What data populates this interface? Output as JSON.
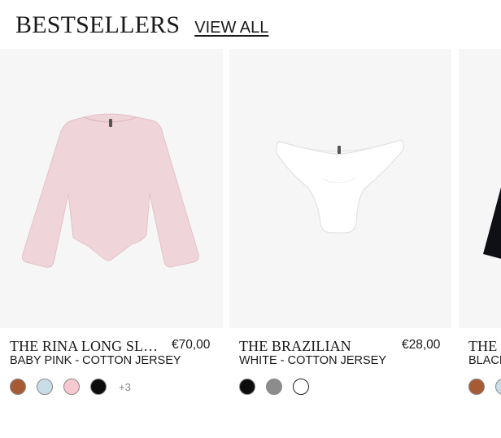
{
  "header": {
    "title": "BESTSELLERS",
    "view_all": "VIEW ALL"
  },
  "products": [
    {
      "name": "THE RINA LONG SL…",
      "price": "€70,00",
      "variant": "BABY PINK - COTTON JERSEY",
      "image": "pink-long-sleeve-top",
      "swatches": [
        "#a75b35",
        "#c9dde9",
        "#f6c9d0",
        "#0d0d0d"
      ],
      "more_colors": "+3"
    },
    {
      "name": "THE BRAZILIAN",
      "price": "€28,00",
      "variant": "WHITE - COTTON JERSEY",
      "image": "white-brief",
      "swatches": [
        "#0d0d0d",
        "#8c8c8c",
        "#ffffff"
      ]
    },
    {
      "name": "THE",
      "variant": "BLACK",
      "image": "black-garment",
      "swatches": [
        "#a75b35",
        "#c9dde9"
      ]
    }
  ]
}
